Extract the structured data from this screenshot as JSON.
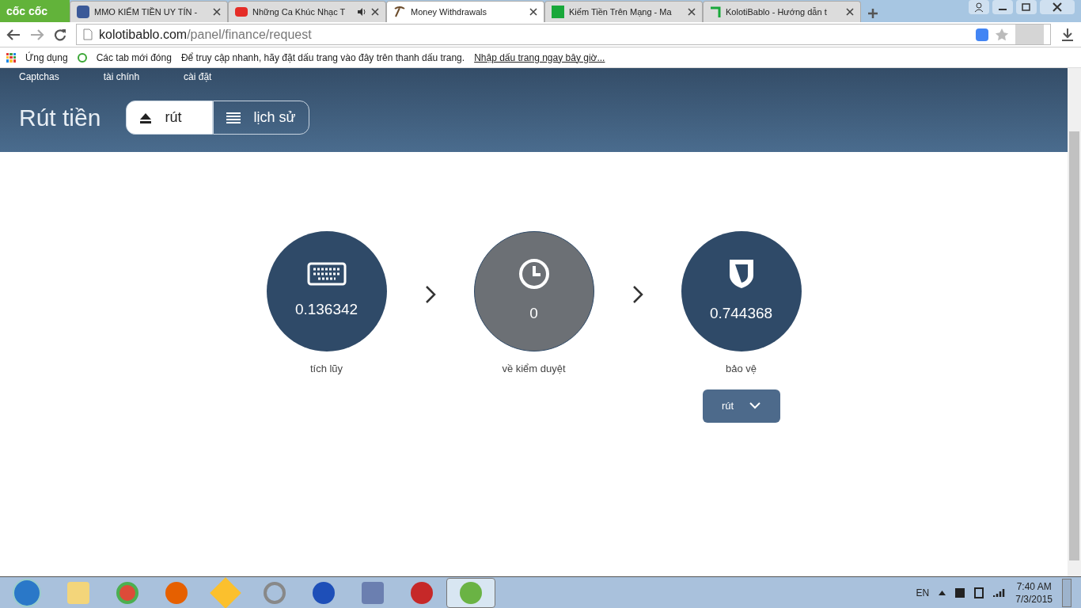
{
  "browser": {
    "logo": "cốc cốc",
    "tabs": [
      {
        "title": "MMO KIẾM TIỀN UY TÍN -",
        "selected": false,
        "audio": false
      },
      {
        "title": "Những Ca Khúc Nhạc T",
        "selected": false,
        "audio": true
      },
      {
        "title": "Money Withdrawals",
        "selected": true,
        "audio": false
      },
      {
        "title": "Kiếm Tiền Trên Mạng - Ma",
        "selected": false,
        "audio": false
      },
      {
        "title": "KolotiBablo - Hướng dẫn t",
        "selected": false,
        "audio": false
      }
    ],
    "url_host": "kolotibablo.com",
    "url_path": "/panel/finance/request",
    "bookmarks": {
      "apps": "Ứng dụng",
      "recent": "Các tab mới đóng",
      "hint": "Để truy cập nhanh, hãy đặt dấu trang vào đây trên thanh dấu trang.",
      "link": "Nhập dấu trang ngay bây giờ..."
    }
  },
  "page": {
    "nav": [
      "Captchas",
      "tài chính",
      "cài đặt"
    ],
    "title": "Rút tiền",
    "tabs": [
      {
        "label": "rút",
        "selected": true
      },
      {
        "label": "lịch sử",
        "selected": false
      }
    ],
    "steps": [
      {
        "value": "0.136342",
        "label": "tích lũy",
        "active": true
      },
      {
        "value": "0",
        "label": "về kiểm duyệt",
        "active": false
      },
      {
        "value": "0.744368",
        "label": "bảo vệ",
        "active": true
      }
    ],
    "withdraw_button": "rút"
  },
  "taskbar": {
    "apps": [
      {
        "selected": false
      },
      {
        "selected": false
      },
      {
        "selected": false
      },
      {
        "selected": false
      },
      {
        "selected": false
      },
      {
        "selected": false
      },
      {
        "selected": false
      },
      {
        "selected": false
      },
      {
        "selected": true
      }
    ],
    "language": "EN",
    "time": "7:40 AM",
    "date": "7/3/2015"
  }
}
